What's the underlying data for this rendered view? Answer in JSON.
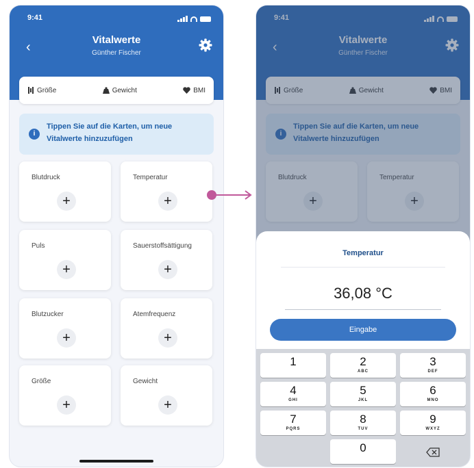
{
  "status_time": "9:41",
  "header": {
    "title": "Vitalwerte",
    "subtitle": "Günther Fischer"
  },
  "tabs": [
    {
      "label": "Größe",
      "icon": "ruler-icon"
    },
    {
      "label": "Gewicht",
      "icon": "weight-icon"
    },
    {
      "label": "BMI",
      "icon": "heart-icon"
    }
  ],
  "info_text": "Tippen Sie auf die Karten, um neue Vitalwerte hinzuzufügen",
  "cards": [
    {
      "label": "Blutdruck"
    },
    {
      "label": "Temperatur"
    },
    {
      "label": "Puls"
    },
    {
      "label": "Sauerstoffsättigung"
    },
    {
      "label": "Blutzucker"
    },
    {
      "label": "Atemfrequenz"
    },
    {
      "label": "Größe"
    },
    {
      "label": "Gewicht"
    }
  ],
  "sheet": {
    "title": "Temperatur",
    "value": "36,08 °C",
    "button_label": "Eingabe"
  },
  "keypad": [
    {
      "digit": "1",
      "letters": ""
    },
    {
      "digit": "2",
      "letters": "ABC"
    },
    {
      "digit": "3",
      "letters": "DEF"
    },
    {
      "digit": "4",
      "letters": "GHI"
    },
    {
      "digit": "5",
      "letters": "JKL"
    },
    {
      "digit": "6",
      "letters": "MNO"
    },
    {
      "digit": "7",
      "letters": "PQRS"
    },
    {
      "digit": "8",
      "letters": "TUV"
    },
    {
      "digit": "9",
      "letters": "WXYZ"
    },
    {
      "digit": "0",
      "letters": ""
    }
  ],
  "colors": {
    "primary": "#2f6dbd",
    "info_bg": "#dcebf8",
    "arrow": "#c0589a"
  }
}
